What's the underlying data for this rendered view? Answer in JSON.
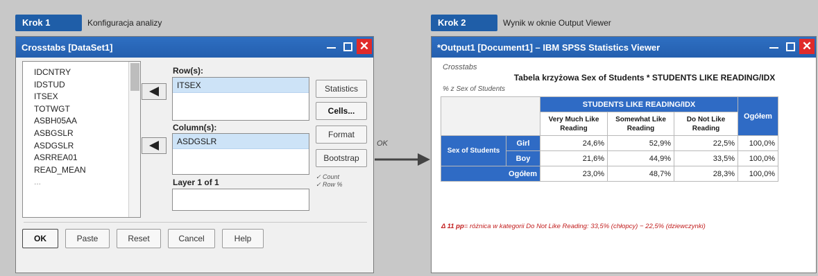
{
  "step1": {
    "badge": "Krok 1",
    "desc": "Konfiguracja analizy"
  },
  "step2": {
    "badge": "Krok 2",
    "desc": "Wynik w oknie Output Viewer"
  },
  "connector_label": "OK",
  "dialog": {
    "title": "Crosstabs [DataSet1]",
    "variables": [
      "IDCNTRY",
      "IDSTUD",
      "ITSEX",
      "TOTWGT",
      "ASBH05AA",
      "ASBGSLR",
      "ASDGSLR",
      "ASRREA01",
      "READ_MEAN",
      "..."
    ],
    "rows_label": "Row(s):",
    "rows_value": "ITSEX",
    "columns_label": "Column(s):",
    "columns_value": "ASDGSLR",
    "layer_label": "Layer 1 of 1",
    "side_buttons": [
      "Statistics",
      "Cells...",
      "Format",
      "Bootstrap"
    ],
    "hint_lines": [
      "✓ Count",
      "✓ Row %"
    ],
    "bottom_buttons": [
      "OK",
      "Paste",
      "Reset",
      "Cancel",
      "Help"
    ]
  },
  "viewer": {
    "title": "*Output1 [Document1] – IBM SPSS Statistics Viewer",
    "section": "Crosstabs",
    "table_title": "Tabela krzyżowa Sex of Students * STUDENTS LIKE READING/IDX",
    "table_sub": "% z Sex of Students",
    "col_group": "STUDENTS LIKE READING/IDX",
    "col_headers": [
      "Very Much Like Reading",
      "Somewhat Like Reading",
      "Do Not Like Reading"
    ],
    "total_header": "Ogółem",
    "row_group": "Sex of Students",
    "rows": [
      {
        "label": "Girl",
        "values": [
          "24,6%",
          "52,9%",
          "22,5%",
          "100,0%"
        ]
      },
      {
        "label": "Boy",
        "values": [
          "21,6%",
          "44,9%",
          "33,5%",
          "100,0%"
        ]
      }
    ],
    "total_row": {
      "label": "Ogółem",
      "values": [
        "23,0%",
        "48,7%",
        "28,3%",
        "100,0%"
      ]
    },
    "note_bold": "Δ 11 pp",
    "note_text": "= różnica w kategorii Do Not Like Reading: 33,5% (chłopcy) − 22,5% (dziewczynki)"
  },
  "colors": {
    "accent": "#1f5ea8",
    "header_blue": "#2f6bc5",
    "note_red": "#c11c1c",
    "close_red": "#e02a2a"
  }
}
